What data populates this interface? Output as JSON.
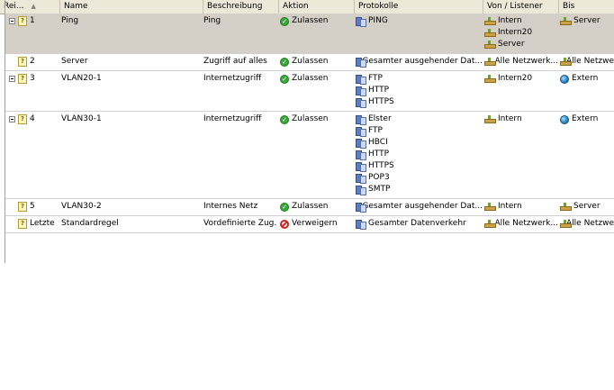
{
  "columns": {
    "reihenfolge": "Rei...",
    "name": "Name",
    "beschreibung": "Beschreibung",
    "aktion": "Aktion",
    "protokolle": "Protokolle",
    "von": "Von / Listener",
    "bis": "Bis"
  },
  "rules": [
    {
      "order": "1",
      "name": "Ping",
      "description": "Ping",
      "action": "Zulassen",
      "protocols": [
        "PING"
      ],
      "from": [
        "Intern",
        "Intern20",
        "Server"
      ],
      "to": [
        "Server"
      ],
      "selected": true
    },
    {
      "order": "2",
      "name": "Server",
      "description": "Zugriff auf alles",
      "action": "Zulassen",
      "protocols": [
        "Gesamter ausgehender Dat..."
      ],
      "from": [
        "Alle Netzwerk..."
      ],
      "to": [
        "Alle Netzwe"
      ]
    },
    {
      "order": "3",
      "name": "VLAN20-1",
      "description": "Internetzugriff",
      "action": "Zulassen",
      "protocols": [
        "FTP",
        "HTTP",
        "HTTPS"
      ],
      "from": [
        "Intern20"
      ],
      "to": [
        "Extern"
      ]
    },
    {
      "order": "4",
      "name": "VLAN30-1",
      "description": "Internetzugriff",
      "action": "Zulassen",
      "protocols": [
        "Elster",
        "FTP",
        "HBCI",
        "HTTP",
        "HTTPS",
        "POP3",
        "SMTP"
      ],
      "from": [
        "Intern"
      ],
      "to": [
        "Extern"
      ]
    },
    {
      "order": "5",
      "name": "VLAN30-2",
      "description": "Internes Netz",
      "action": "Zulassen",
      "protocols": [
        "Gesamter ausgehender Dat..."
      ],
      "from": [
        "Intern"
      ],
      "to": [
        "Server"
      ]
    },
    {
      "order": "Letzte",
      "name": "Standardregel",
      "description": "Vordefinierte Zug...",
      "action": "Verweigern",
      "protocols": [
        "Gesamter Datenverkehr"
      ],
      "from": [
        "Alle Netzwerk..."
      ],
      "to": [
        "Alle Netzwe"
      ]
    }
  ]
}
